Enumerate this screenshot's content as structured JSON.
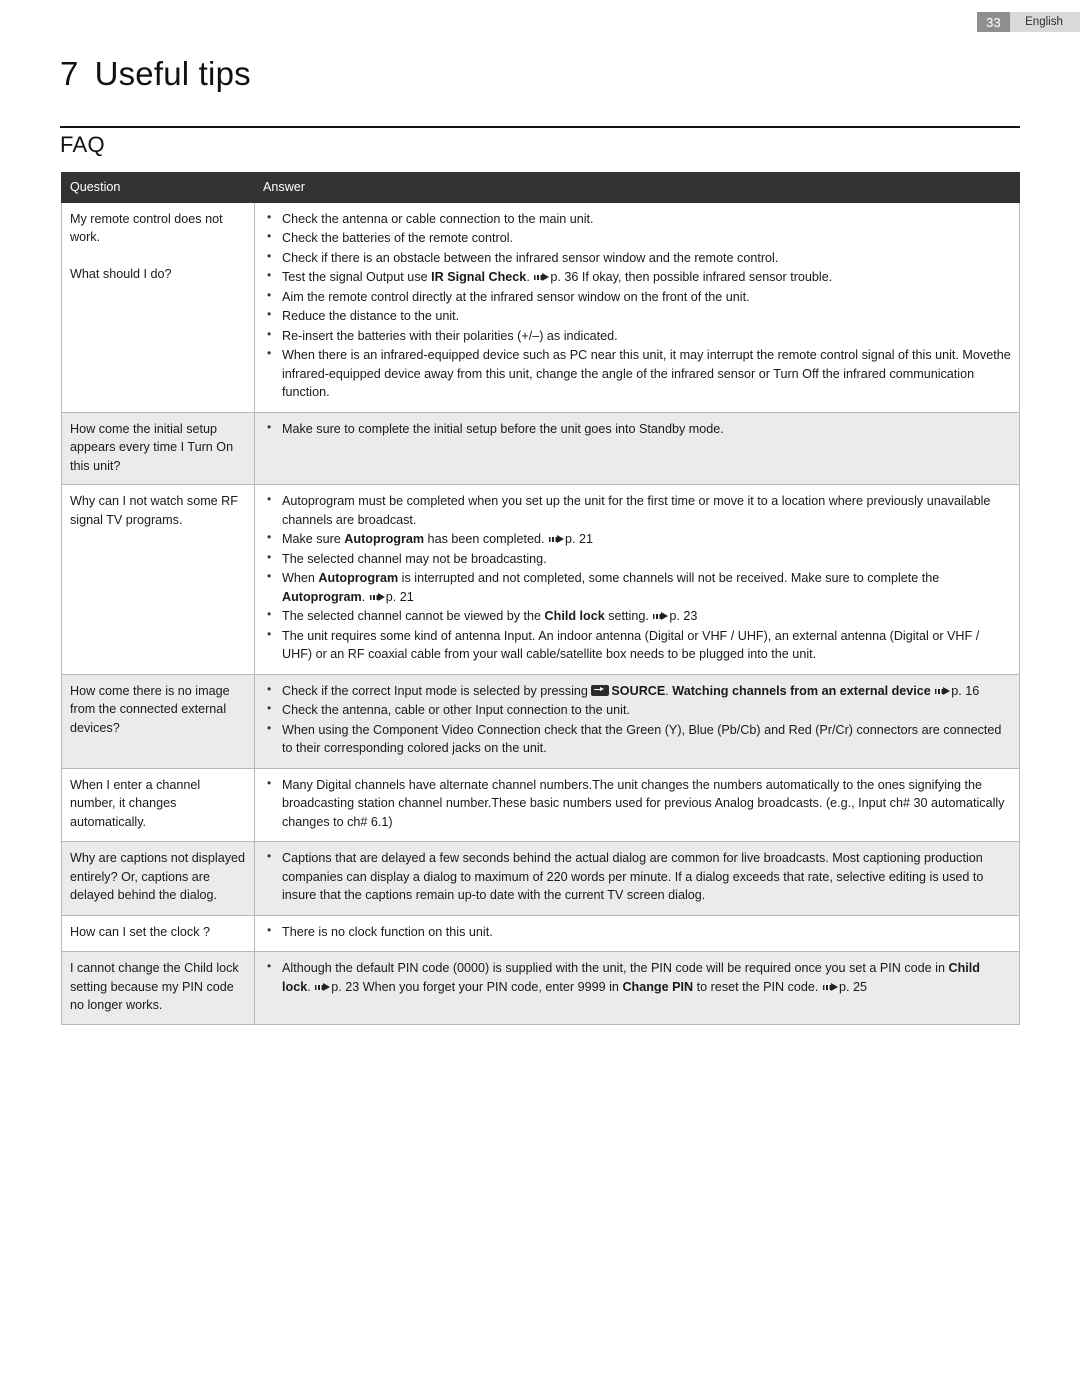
{
  "header": {
    "page_number": "33",
    "language": "English"
  },
  "chapter": {
    "number": "7",
    "title": "Useful tips"
  },
  "section": {
    "title": "FAQ"
  },
  "table": {
    "columns": {
      "question": "Question",
      "answer": "Answer"
    },
    "rows": [
      {
        "question": "My remote control does not work.\nWhat should I do?",
        "answers": [
          "Check the antenna or cable connection to the main unit.",
          "Check the batteries of the remote control.",
          "Check if there is an obstacle between the infrared sensor window and the remote control.",
          "Test the signal Output use IR Signal Check. ➡ p. 36 If okay, then possible infrared sensor trouble.",
          "Aim the remote control directly at the infrared sensor window on the front of the unit.",
          "Reduce the distance to the unit.",
          "Re-insert the batteries with their polarities (+/–) as indicated.",
          "When there is an infrared-equipped device such as PC near this unit, it may interrupt the remote control signal of this unit. Movethe infrared-equipped device away from this unit, change the angle of the infrared sensor or Turn Off the infrared communication function."
        ]
      },
      {
        "question": "How come the initial setup appears every time I Turn On this unit?",
        "answers": [
          "Make sure to complete the initial setup before the unit goes into Standby mode."
        ]
      },
      {
        "question": "Why can I not watch some RF signal TV programs.",
        "answers": [
          "Autoprogram must be completed when you set up the unit for the first time or move it to a location where previously unavailable channels are broadcast.",
          "Make sure Autoprogram has been completed. ➡ p. 21",
          "The selected channel may not be broadcasting.",
          "When Autoprogram is interrupted and not completed, some channels will not be received. Make sure to complete the Autoprogram. ➡ p. 21",
          "The selected channel cannot be viewed by the Child lock setting. ➡ p. 23",
          "The unit requires some kind of antenna Input. An indoor antenna (Digital or VHF / UHF), an external antenna (Digital or VHF / UHF) or an RF coaxial cable from your wall cable/satellite box needs to be plugged into the unit."
        ]
      },
      {
        "question": "How come there is no image from the connected external devices?",
        "answers": [
          "Check if the correct Input mode is selected by pressing ⊞ SOURCE. Watching channels from an external device ➡ p. 16",
          "Check the antenna, cable or other Input connection to the unit.",
          "When using the Component Video Connection check that the Green (Y), Blue (Pb/Cb) and Red (Pr/Cr) connectors are connected to their corresponding colored jacks on the unit."
        ]
      },
      {
        "question": "When I enter a channel number, it changes automatically.",
        "answers": [
          "Many Digital channels have alternate channel numbers.The unit changes the numbers automatically to the ones signifying the broadcasting station channel number.These basic numbers used for previous Analog broadcasts. (e.g., Input ch# 30 automatically changes to ch# 6.1)"
        ]
      },
      {
        "question": "Why are captions not displayed entirely? Or, captions are delayed behind the dialog.",
        "answers": [
          "Captions that are delayed a few seconds behind the actual dialog are common for live broadcasts. Most captioning production companies can display a dialog to maximum of 220 words per minute. If a dialog exceeds that rate, selective editing is used to insure that the captions remain up-to date with the current TV screen dialog."
        ]
      },
      {
        "question": "How can I set the clock ?",
        "answers": [
          "There is no clock function on this unit."
        ]
      },
      {
        "question": "I cannot change the Child lock setting because my PIN code no longer works.",
        "answers": [
          "Although the default PIN code (0000) is supplied with the unit, the PIN code will be required once you set a PIN code in Child lock. ➡ p. 23 When you forget your PIN code, enter 9999 in Change PIN to reset the PIN code. ➡ p. 25"
        ]
      }
    ]
  }
}
